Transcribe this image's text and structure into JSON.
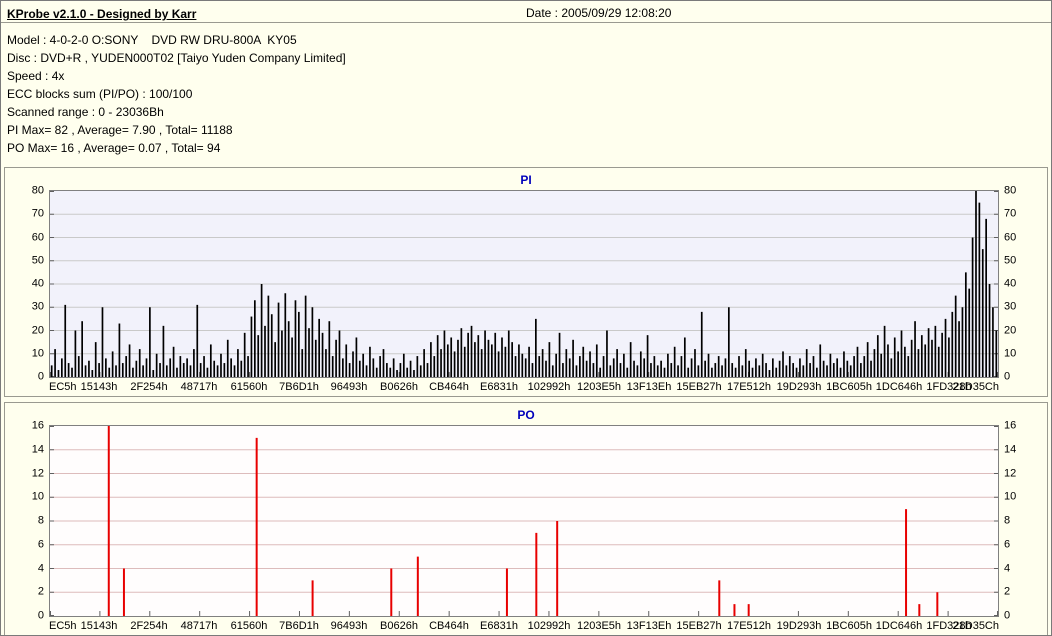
{
  "header": {
    "title": "KProbe v2.1.0 - Designed by Karr",
    "date": "Date : 2005/09/29 12:08:20"
  },
  "info": {
    "lines": [
      "Model : 4-0-2-0 O:SONY    DVD RW DRU-800A  KY05",
      "Disc : DVD+R , YUDEN000T02 [Taiyo Yuden Company Limited]",
      "Speed : 4x",
      "ECC blocks sum (PI/PO) : 100/100",
      "Scanned range : 0 - 23036Bh",
      "PI Max= 82 , Average= 7.90 , Total= 11188",
      "PO Max= 16 , Average= 0.07 , Total= 94"
    ]
  },
  "chart_data": [
    {
      "type": "bar",
      "title": "PI",
      "color": "#000000",
      "plot_bg": "#f2f2fb",
      "grid_color": "#c9c9c9",
      "ylim": [
        0,
        80
      ],
      "yticks": [
        0,
        10,
        20,
        30,
        40,
        50,
        60,
        70,
        80
      ],
      "x_labels": [
        "EC5h",
        "15143h",
        "2F254h",
        "48717h",
        "61560h",
        "7B6D1h",
        "96493h",
        "B0626h",
        "CB464h",
        "E6831h",
        "102992h",
        "1203E5h",
        "13F13Eh",
        "15EB27h",
        "17E512h",
        "19D293h",
        "1BC605h",
        "1DC646h",
        "1FD328h",
        "21D35Ch"
      ],
      "max": 82,
      "average": 7.9,
      "total": 11188,
      "values": [
        5,
        12,
        3,
        8,
        31,
        6,
        4,
        20,
        9,
        24,
        5,
        7,
        3,
        15,
        6,
        30,
        8,
        4,
        11,
        5,
        23,
        6,
        9,
        14,
        4,
        7,
        12,
        5,
        8,
        30,
        3,
        10,
        6,
        22,
        5,
        8,
        13,
        4,
        9,
        6,
        8,
        5,
        12,
        31,
        6,
        9,
        4,
        14,
        7,
        5,
        10,
        6,
        16,
        8,
        5,
        12,
        7,
        19,
        9,
        26,
        33,
        18,
        40,
        22,
        35,
        27,
        15,
        32,
        20,
        36,
        24,
        17,
        33,
        28,
        12,
        35,
        21,
        30,
        16,
        25,
        19,
        12,
        24,
        9,
        16,
        20,
        8,
        14,
        6,
        11,
        17,
        7,
        10,
        5,
        13,
        8,
        4,
        9,
        12,
        6,
        4,
        8,
        3,
        6,
        10,
        4,
        7,
        3,
        9,
        5,
        12,
        6,
        15,
        9,
        18,
        12,
        20,
        14,
        17,
        11,
        16,
        21,
        13,
        19,
        22,
        15,
        18,
        12,
        20,
        16,
        14,
        19,
        11,
        17,
        13,
        20,
        15,
        9,
        14,
        10,
        8,
        13,
        6,
        25,
        9,
        12,
        7,
        15,
        5,
        10,
        19,
        6,
        12,
        8,
        16,
        5,
        9,
        13,
        7,
        11,
        6,
        14,
        4,
        9,
        20,
        5,
        8,
        12,
        6,
        10,
        4,
        15,
        7,
        5,
        11,
        8,
        18,
        6,
        9,
        5,
        7,
        4,
        10,
        6,
        13,
        5,
        9,
        17,
        4,
        8,
        12,
        5,
        28,
        7,
        10,
        4,
        6,
        9,
        5,
        8,
        30,
        6,
        4,
        9,
        5,
        12,
        7,
        4,
        8,
        5,
        10,
        6,
        3,
        8,
        4,
        7,
        11,
        5,
        9,
        6,
        4,
        8,
        5,
        12,
        6,
        9,
        4,
        14,
        7,
        5,
        10,
        6,
        8,
        4,
        11,
        7,
        5,
        9,
        13,
        6,
        9,
        15,
        7,
        12,
        18,
        10,
        22,
        14,
        8,
        17,
        11,
        20,
        13,
        9,
        16,
        24,
        12,
        18,
        14,
        21,
        16,
        22,
        13,
        19,
        25,
        17,
        28,
        35,
        24,
        30,
        45,
        38,
        60,
        82,
        75,
        55,
        68,
        40,
        30,
        20
      ]
    },
    {
      "type": "bar",
      "title": "PO",
      "color": "#e80000",
      "plot_bg": "#fffdfd",
      "grid_color": "#ddbcbc",
      "ylim": [
        0,
        16
      ],
      "yticks": [
        0,
        2,
        4,
        6,
        8,
        10,
        12,
        14,
        16
      ],
      "x_labels": [
        "EC5h",
        "15143h",
        "2F254h",
        "48717h",
        "61560h",
        "7B6D1h",
        "96493h",
        "B0626h",
        "CB464h",
        "E6831h",
        "102992h",
        "1203E5h",
        "13F13Eh",
        "15EB27h",
        "17E512h",
        "19D293h",
        "1BC605h",
        "1DC646h",
        "1FD328h",
        "21D35Ch"
      ],
      "max": 16,
      "average": 0.07,
      "total": 94,
      "points": [
        {
          "x": 0.062,
          "v": 16
        },
        {
          "x": 0.078,
          "v": 4
        },
        {
          "x": 0.218,
          "v": 15
        },
        {
          "x": 0.277,
          "v": 3
        },
        {
          "x": 0.36,
          "v": 4
        },
        {
          "x": 0.388,
          "v": 5
        },
        {
          "x": 0.482,
          "v": 4
        },
        {
          "x": 0.513,
          "v": 7
        },
        {
          "x": 0.535,
          "v": 8
        },
        {
          "x": 0.706,
          "v": 3
        },
        {
          "x": 0.722,
          "v": 1
        },
        {
          "x": 0.737,
          "v": 1
        },
        {
          "x": 0.903,
          "v": 9
        },
        {
          "x": 0.917,
          "v": 1
        },
        {
          "x": 0.936,
          "v": 2
        }
      ]
    }
  ]
}
